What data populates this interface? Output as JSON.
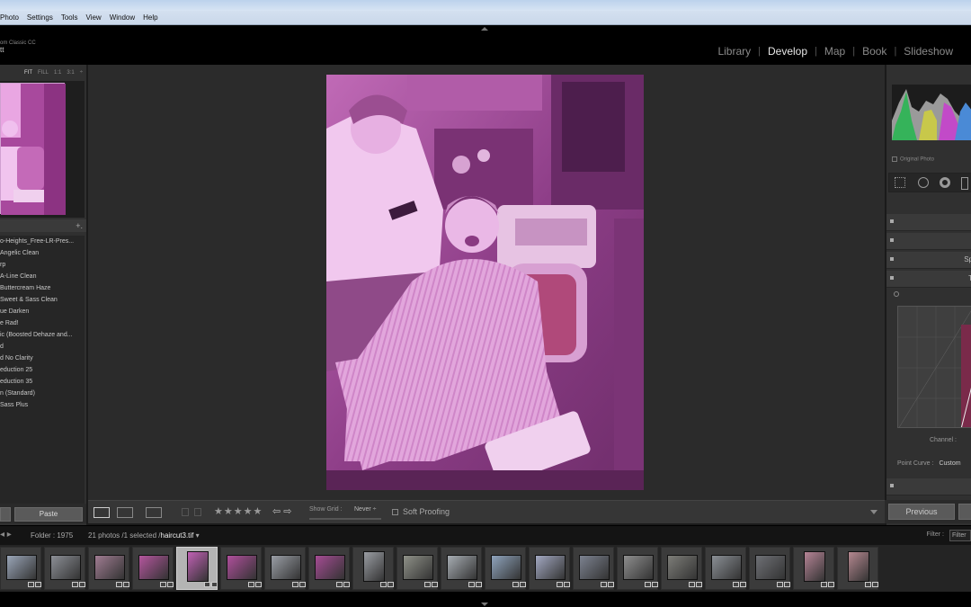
{
  "menu": {
    "items": [
      "Photo",
      "Settings",
      "Tools",
      "View",
      "Window",
      "Help"
    ]
  },
  "identity": {
    "product": "om Classic CC",
    "user": "tt"
  },
  "modules": {
    "items": [
      "Library",
      "Develop",
      "Map",
      "Book",
      "Slideshow"
    ],
    "active": "Develop"
  },
  "navigator": {
    "zoom_options": [
      "FIT",
      "FILL",
      "1:1",
      "3:1"
    ],
    "selected": "FIT"
  },
  "presets": {
    "add_label": "+.",
    "items": [
      "o-Heights_Free-LR-Pres...",
      "Angelic Clean",
      "rp",
      "A-Line Clean",
      "Buttercream Haze",
      "Sweet & Sass Clean",
      "ue Darken",
      "e Rad!",
      "ic (Boosted Dehaze and...",
      "d",
      "d No Clarity",
      "eduction 25",
      "eduction 35",
      "n (Standard)",
      "Sass Plus"
    ]
  },
  "left_buttons": {
    "paste": "Paste"
  },
  "toolbar": {
    "stars": "★★★★★",
    "nav_arrows": "⇦ ⇨",
    "show_grid_label": "Show Grid :",
    "show_grid_value": "Never ÷",
    "soft_proofing": "Soft Proofing"
  },
  "right_panel": {
    "original_photo": "Original Photo",
    "sections": [
      "",
      "",
      "Sp",
      "T"
    ],
    "channel_label": "Channel :",
    "point_curve_label": "Point Curve :",
    "point_curve_value": "Custom",
    "previous_button": "Previous"
  },
  "filmstrip_bar": {
    "folder": "Folder : 1975",
    "count": "21 photos /1 selected /",
    "filename": "haircut3.tif",
    "filter_label": "Filter :",
    "filter_value": "Filter"
  },
  "filmstrip": {
    "thumbnails": [
      {
        "color": "#9aa6b8",
        "portrait": false
      },
      {
        "color": "#8c8f96",
        "portrait": false
      },
      {
        "color": "#a07c92",
        "portrait": false
      },
      {
        "color": "#b5569e",
        "portrait": false
      },
      {
        "color": "#c161b5",
        "portrait": true,
        "selected": true
      },
      {
        "color": "#b04f9c",
        "portrait": false
      },
      {
        "color": "#9a9ea6",
        "portrait": false
      },
      {
        "color": "#a64c94",
        "portrait": false
      },
      {
        "color": "#9a9da3",
        "portrait": true
      },
      {
        "color": "#8f9188",
        "portrait": false
      },
      {
        "color": "#a7adb3",
        "portrait": false
      },
      {
        "color": "#8fa4bd",
        "portrait": false
      },
      {
        "color": "#a3a9c2",
        "portrait": false
      },
      {
        "color": "#7c8290",
        "portrait": false
      },
      {
        "color": "#8e8e8e",
        "portrait": false
      },
      {
        "color": "#7d7d78",
        "portrait": false
      },
      {
        "color": "#8a8f95",
        "portrait": false
      },
      {
        "color": "#6e7075",
        "portrait": false
      },
      {
        "color": "#b68496",
        "portrait": true
      },
      {
        "color": "#b58890",
        "portrait": true
      }
    ]
  },
  "colors": {
    "tint": "#c05ab8",
    "accent": "#e6e6e6"
  }
}
